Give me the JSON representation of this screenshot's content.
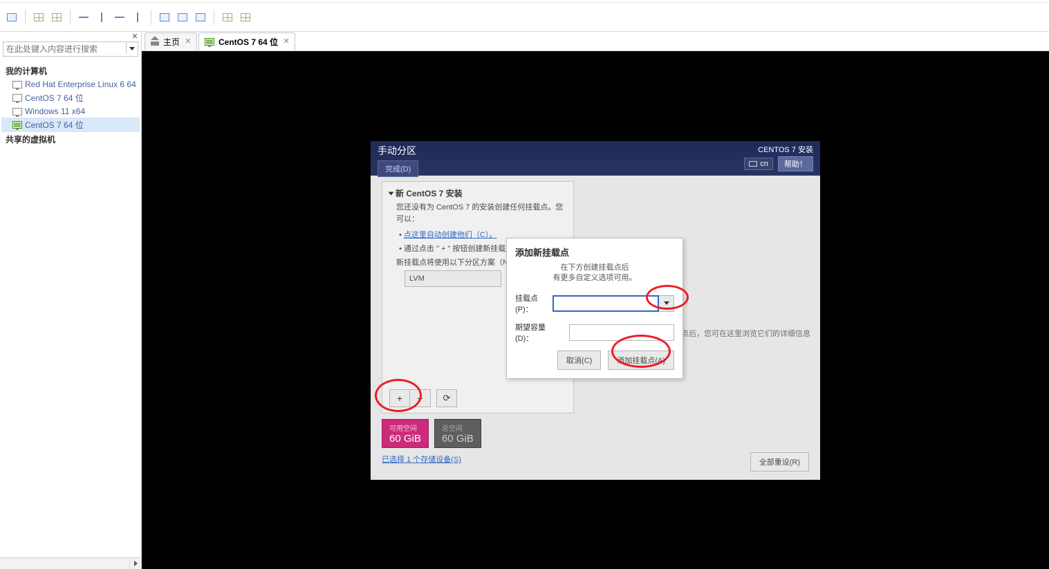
{
  "sidebar": {
    "search_placeholder": "在此处键入内容进行搜索",
    "root1": "我的计算机",
    "items": [
      {
        "label": "Red Hat Enterprise Linux 6 64"
      },
      {
        "label": "CentOS 7 64 位"
      },
      {
        "label": "Windows 11 x64"
      },
      {
        "label": "CentOS 7 64 位"
      }
    ],
    "root2": "共享的虚拟机"
  },
  "tabs": {
    "home": "主页",
    "vm": "CentOS 7 64 位"
  },
  "anaconda": {
    "title": "手动分区",
    "done": "完成(D)",
    "install_label": "CENTOS 7 安装",
    "keyboard": "cn",
    "help": "帮助！",
    "section_heading": "新 CentOS 7 安装",
    "no_mount_msg": "您还没有为 CentOS 7 的安装创建任何挂载点。您可以：",
    "auto_link": "点这里自动创建他们（C）。",
    "plus_hint": "通过点击 \" + \" 按钮创建新挂载点。",
    "scheme_label": "新挂载点将使用以下分区方案（N）：",
    "scheme_value": "LVM",
    "right_hint": "载点后，您可在这里浏览它们的详细信息",
    "space_available_label": "可用空间",
    "space_available_value": "60 GiB",
    "space_total_label": "总空间",
    "space_total_value": "60 GiB",
    "storage_link": "已选择 1 个存储设备(S)",
    "reset_all": "全部重设(R)"
  },
  "dialog": {
    "title": "添加新挂载点",
    "msg1": "在下方创建挂载点后",
    "msg2": "有更多自定义选项可用。",
    "mount_label": "挂载点(P)：",
    "capacity_label": "期望容量(D)：",
    "cancel": "取消(C)",
    "add": "添加挂载点(A)"
  }
}
